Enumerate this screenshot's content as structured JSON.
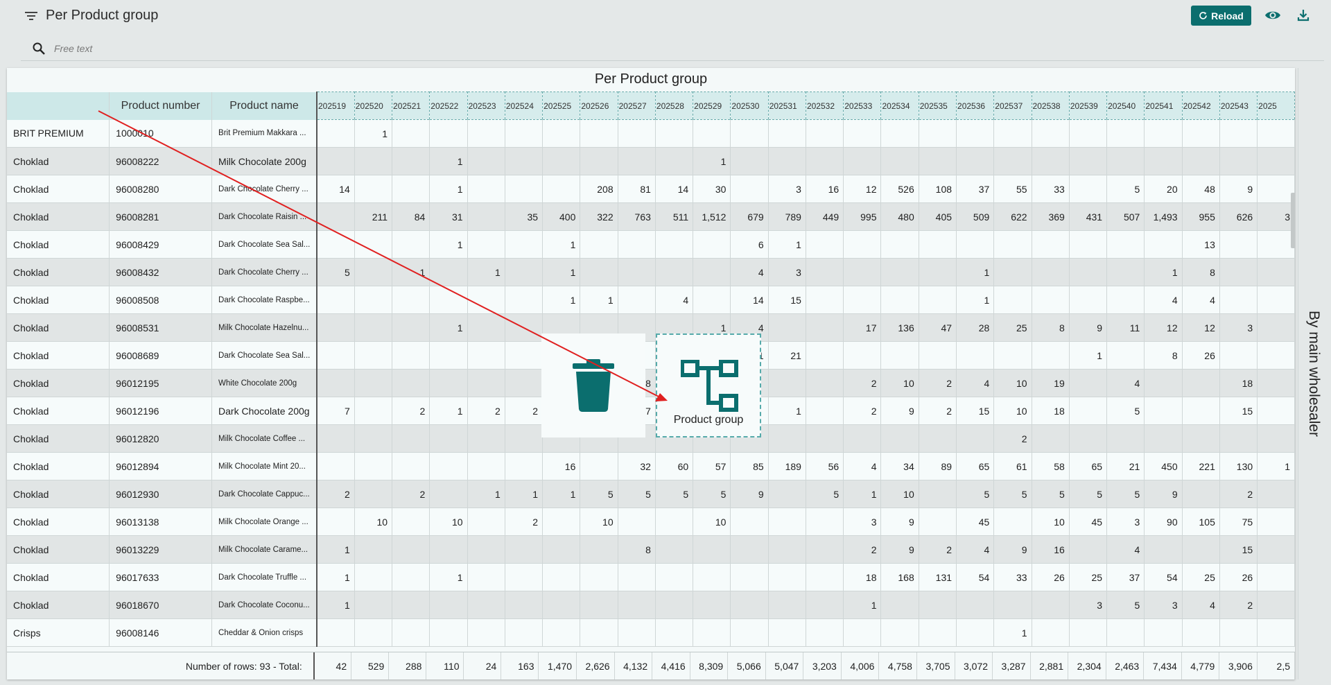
{
  "header": {
    "title": "Per Product group",
    "reload_label": "Reload",
    "search_placeholder": "Free text"
  },
  "panel": {
    "title": "Per Product group",
    "columns": {
      "product_number": "Product number",
      "product_name": "Product name"
    },
    "periods": [
      "202519",
      "202520",
      "202521",
      "202522",
      "202523",
      "202524",
      "202525",
      "202526",
      "202527",
      "202528",
      "202529",
      "202530",
      "202531",
      "202532",
      "202533",
      "202534",
      "202535",
      "202536",
      "202537",
      "202538",
      "202539",
      "202540",
      "202541",
      "202542",
      "202543",
      "2025"
    ],
    "rows": [
      {
        "group": "BRIT PREMIUM",
        "number": "1000010",
        "name": "Brit Premium Makkara ...",
        "big": false,
        "v": [
          "",
          "1",
          "",
          "",
          "",
          "",
          "",
          "",
          "",
          "",
          "",
          "",
          "",
          "",
          "",
          "",
          "",
          "",
          "",
          "",
          "",
          "",
          "",
          "",
          "",
          ""
        ]
      },
      {
        "group": "Choklad",
        "number": "96008222",
        "name": "Milk Chocolate 200g",
        "big": true,
        "v": [
          "",
          "",
          "",
          "1",
          "",
          "",
          "",
          "",
          "",
          "",
          "1",
          "",
          "",
          "",
          "",
          "",
          "",
          "",
          "",
          "",
          "",
          "",
          "",
          "",
          "",
          ""
        ]
      },
      {
        "group": "Choklad",
        "number": "96008280",
        "name": "Dark Chocolate Cherry ...",
        "big": false,
        "v": [
          "14",
          "",
          "",
          "1",
          "",
          "",
          "",
          "208",
          "81",
          "14",
          "30",
          "",
          "3",
          "16",
          "12",
          "526",
          "108",
          "37",
          "55",
          "33",
          "",
          "5",
          "20",
          "48",
          "9",
          ""
        ]
      },
      {
        "group": "Choklad",
        "number": "96008281",
        "name": "Dark Chocolate Raisin ...",
        "big": false,
        "v": [
          "",
          "211",
          "84",
          "31",
          "",
          "35",
          "400",
          "322",
          "763",
          "511",
          "1,512",
          "679",
          "789",
          "449",
          "995",
          "480",
          "405",
          "509",
          "622",
          "369",
          "431",
          "507",
          "1,493",
          "955",
          "626",
          "3"
        ]
      },
      {
        "group": "Choklad",
        "number": "96008429",
        "name": "Dark Chocolate Sea Sal...",
        "big": false,
        "v": [
          "",
          "",
          "",
          "1",
          "",
          "",
          "1",
          "",
          "",
          "",
          "",
          "6",
          "1",
          "",
          "",
          "",
          "",
          "",
          "",
          "",
          "",
          "",
          "",
          "13",
          "",
          ""
        ]
      },
      {
        "group": "Choklad",
        "number": "96008432",
        "name": "Dark Chocolate Cherry ...",
        "big": false,
        "v": [
          "5",
          "",
          "1",
          "",
          "1",
          "",
          "1",
          "",
          "",
          "",
          "",
          "4",
          "3",
          "",
          "",
          "",
          "",
          "1",
          "",
          "",
          "",
          "",
          "1",
          "8",
          "",
          ""
        ]
      },
      {
        "group": "Choklad",
        "number": "96008508",
        "name": "Dark Chocolate Raspbe...",
        "big": false,
        "v": [
          "",
          "",
          "",
          "",
          "",
          "",
          "1",
          "1",
          "",
          "4",
          "",
          "14",
          "15",
          "",
          "",
          "",
          "",
          "1",
          "",
          "",
          "",
          "",
          "4",
          "4",
          "",
          ""
        ]
      },
      {
        "group": "Choklad",
        "number": "96008531",
        "name": "Milk Chocolate Hazelnu...",
        "big": false,
        "v": [
          "",
          "",
          "",
          "1",
          "",
          "",
          "",
          "",
          "",
          "",
          "1",
          "4",
          "",
          "",
          "17",
          "136",
          "47",
          "28",
          "25",
          "8",
          "9",
          "11",
          "12",
          "12",
          "3",
          ""
        ]
      },
      {
        "group": "Choklad",
        "number": "96008689",
        "name": "Dark Chocolate Sea Sal...",
        "big": false,
        "v": [
          "",
          "",
          "",
          "",
          "",
          "",
          "",
          "",
          "",
          "",
          "",
          "21",
          "21",
          "",
          "",
          "",
          "",
          "",
          "",
          "",
          "1",
          "",
          "8",
          "26",
          "",
          ""
        ]
      },
      {
        "group": "Choklad",
        "number": "96012195",
        "name": "White Chocolate 200g",
        "big": false,
        "v": [
          "",
          "",
          "",
          "",
          "",
          "",
          "",
          "",
          "8",
          "",
          "",
          "",
          "",
          "",
          "2",
          "10",
          "2",
          "4",
          "10",
          "19",
          "",
          "4",
          "",
          "",
          "18",
          ""
        ]
      },
      {
        "group": "Choklad",
        "number": "96012196",
        "name": "Dark Chocolate 200g",
        "big": true,
        "v": [
          "7",
          "",
          "2",
          "1",
          "2",
          "2",
          "",
          "",
          "7",
          "",
          "",
          "",
          "1",
          "",
          "2",
          "9",
          "2",
          "15",
          "10",
          "18",
          "",
          "5",
          "",
          "",
          "15",
          ""
        ]
      },
      {
        "group": "Choklad",
        "number": "96012820",
        "name": "Milk Chocolate Coffee ...",
        "big": false,
        "v": [
          "",
          "",
          "",
          "",
          "",
          "",
          "",
          "",
          "",
          "",
          "",
          "",
          "",
          "",
          "",
          "",
          "",
          "",
          "2",
          "",
          "",
          "",
          "",
          "",
          "",
          ""
        ]
      },
      {
        "group": "Choklad",
        "number": "96012894",
        "name": "Milk Chocolate Mint 20...",
        "big": false,
        "v": [
          "",
          "",
          "",
          "",
          "",
          "",
          "16",
          "",
          "32",
          "60",
          "57",
          "85",
          "189",
          "56",
          "4",
          "34",
          "89",
          "65",
          "61",
          "58",
          "65",
          "21",
          "450",
          "221",
          "130",
          "1"
        ]
      },
      {
        "group": "Choklad",
        "number": "96012930",
        "name": "Dark Chocolate Cappuc...",
        "big": false,
        "v": [
          "2",
          "",
          "2",
          "",
          "1",
          "1",
          "1",
          "5",
          "5",
          "5",
          "5",
          "9",
          "",
          "5",
          "1",
          "10",
          "",
          "5",
          "5",
          "5",
          "5",
          "5",
          "9",
          "",
          "2",
          ""
        ]
      },
      {
        "group": "Choklad",
        "number": "96013138",
        "name": "Milk Chocolate Orange ...",
        "big": false,
        "v": [
          "",
          "10",
          "",
          "10",
          "",
          "2",
          "",
          "10",
          "",
          "",
          "10",
          "",
          "",
          "",
          "3",
          "9",
          "",
          "45",
          "",
          "10",
          "45",
          "3",
          "90",
          "105",
          "75",
          ""
        ]
      },
      {
        "group": "Choklad",
        "number": "96013229",
        "name": "Milk Chocolate Carame...",
        "big": false,
        "v": [
          "1",
          "",
          "",
          "",
          "",
          "",
          "",
          "",
          "8",
          "",
          "",
          "",
          "",
          "",
          "2",
          "9",
          "2",
          "4",
          "9",
          "16",
          "",
          "4",
          "",
          "",
          "15",
          ""
        ]
      },
      {
        "group": "Choklad",
        "number": "96017633",
        "name": "Dark Chocolate Truffle ...",
        "big": false,
        "v": [
          "1",
          "",
          "",
          "1",
          "",
          "",
          "",
          "",
          "",
          "",
          "",
          "",
          "",
          "",
          "18",
          "168",
          "131",
          "54",
          "33",
          "26",
          "25",
          "37",
          "54",
          "25",
          "26",
          ""
        ]
      },
      {
        "group": "Choklad",
        "number": "96018670",
        "name": "Dark Chocolate Coconu...",
        "big": false,
        "v": [
          "1",
          "",
          "",
          "",
          "",
          "",
          "",
          "",
          "",
          "",
          "",
          "",
          "",
          "",
          "1",
          "",
          "",
          "",
          "",
          "",
          "3",
          "5",
          "3",
          "4",
          "2",
          ""
        ]
      },
      {
        "group": "Crisps",
        "number": "96008146",
        "name": "Cheddar & Onion crisps",
        "big": false,
        "v": [
          "",
          "",
          "",
          "",
          "",
          "",
          "",
          "",
          "",
          "",
          "",
          "",
          "",
          "",
          "",
          "",
          "",
          "",
          "1",
          "",
          "",
          "",
          "",
          "",
          "",
          ""
        ]
      }
    ],
    "footer": {
      "rows_info": "Number of rows: 93   -   Total:",
      "totals": [
        "42",
        "529",
        "288",
        "110",
        "24",
        "163",
        "1,470",
        "2,626",
        "4,132",
        "4,416",
        "8,309",
        "5,066",
        "5,047",
        "3,203",
        "4,006",
        "4,758",
        "3,705",
        "3,072",
        "3,287",
        "2,881",
        "2,304",
        "2,463",
        "7,434",
        "4,779",
        "3,906",
        "2,5"
      ]
    }
  },
  "side_tab": "By main wholesaler",
  "drop_zone_label": "Product group"
}
